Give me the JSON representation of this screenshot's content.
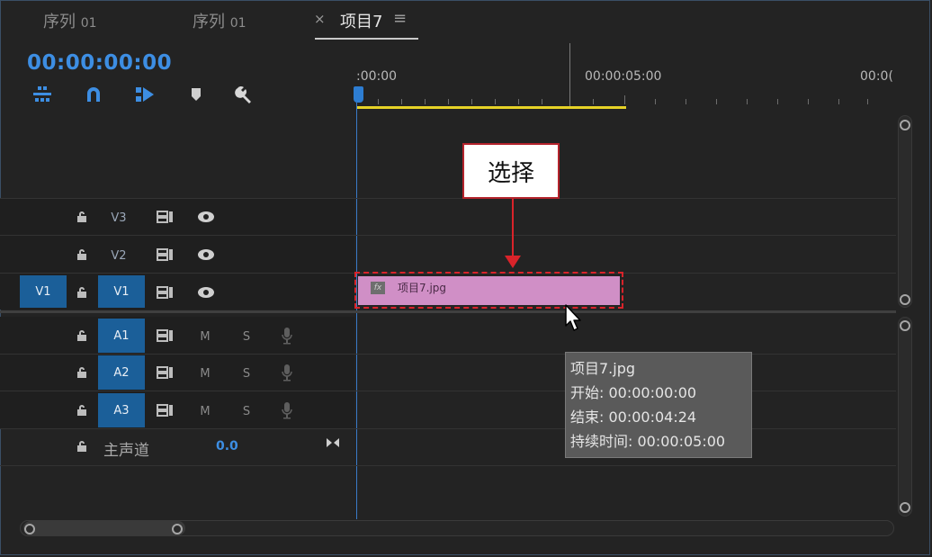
{
  "tabs": [
    {
      "label": "序列",
      "num": "01"
    },
    {
      "label": "序列",
      "num": "01"
    },
    {
      "label": "项目7",
      "close": "×",
      "menu": "≡"
    }
  ],
  "timecode": "00:00:00:00",
  "toolbar": {
    "icons": [
      "snap-nested-icon",
      "magnet-snap-icon",
      "linked-selection-icon",
      "add-marker-icon",
      "wrench-settings-icon"
    ]
  },
  "ruler": {
    "labels": [
      ":00:00",
      "00:00:05:00",
      "00:0("
    ],
    "work_area_color": "#e6d227",
    "playhead_color": "#2d7dd2"
  },
  "tracks": {
    "video": [
      {
        "name": "V3",
        "source_patch": ""
      },
      {
        "name": "V2",
        "source_patch": ""
      },
      {
        "name": "V1",
        "source_patch": "V1"
      }
    ],
    "audio": [
      {
        "name": "A1",
        "mute": "M",
        "solo": "S"
      },
      {
        "name": "A2",
        "mute": "M",
        "solo": "S"
      },
      {
        "name": "A3",
        "mute": "M",
        "solo": "S"
      }
    ],
    "master": {
      "label": "主声道",
      "value": "0.0"
    }
  },
  "clip": {
    "name": "项目7.jpg",
    "fx": "fx",
    "color": "#d08fc6"
  },
  "callout": {
    "text": "选择",
    "color": "#d9232a"
  },
  "tooltip": {
    "name": "项目7.jpg",
    "start": "开始: 00:00:00:00",
    "end": "结束: 00:00:04:24",
    "duration": "持续时间: 00:00:05:00"
  },
  "colors": {
    "accent": "#3d8ee3",
    "track_target": "#1b5f99",
    "background": "#232323"
  }
}
